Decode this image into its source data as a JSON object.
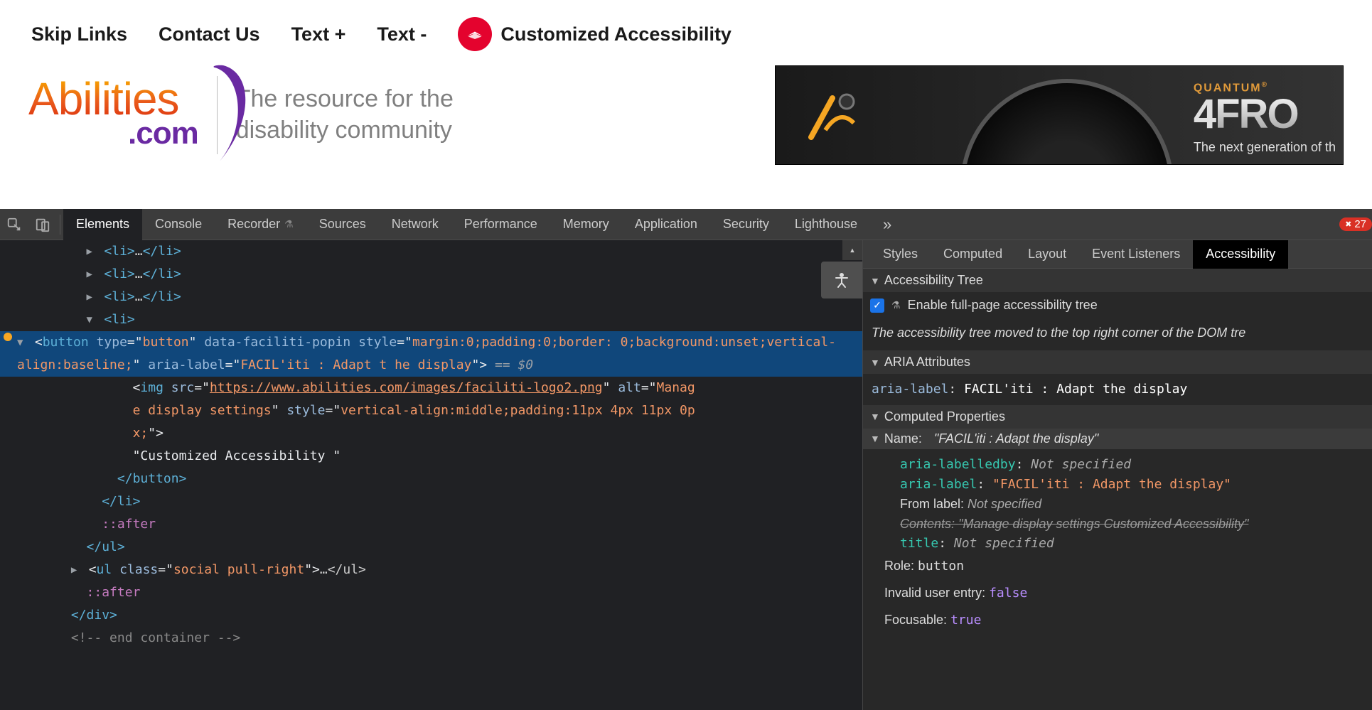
{
  "topnav": {
    "skip_links": "Skip Links",
    "contact_us": "Contact Us",
    "text_plus": "Text +",
    "text_minus": "Text -",
    "custom_accessibility": "Customized Accessibility"
  },
  "logo": {
    "main": "Abilities",
    "sub": ".com",
    "tagline_line1": "The resource for the",
    "tagline_line2": "disability community"
  },
  "ad": {
    "quantum": "QUANTUM",
    "four": "4",
    "fro": "FRO",
    "subtitle": "The next generation of th"
  },
  "devtools_tabs": {
    "elements": "Elements",
    "console": "Console",
    "recorder": "Recorder",
    "sources": "Sources",
    "network": "Network",
    "performance": "Performance",
    "memory": "Memory",
    "application": "Application",
    "security": "Security",
    "lighthouse": "Lighthouse",
    "error_count": "27"
  },
  "side_tabs": {
    "styles": "Styles",
    "computed": "Computed",
    "layout": "Layout",
    "event_listeners": "Event Listeners",
    "accessibility": "Accessibility"
  },
  "dom": {
    "li_collapsed": "<li>…</li>",
    "li_open": "<li>",
    "button_tag_open": "button",
    "button_type_attr": "type",
    "button_type_val": "button",
    "button_data_attr": "data-faciliti-popin",
    "button_style_attr": "style",
    "button_style_val_1": "margin:0;padding:0;border:",
    "button_style_val_2": "0;background:unset;vertical-align:baseline;",
    "button_aria_attr": "aria-label",
    "button_aria_val": "FACIL'iti : Adapt t",
    "button_aria_val_2": "he display",
    "selected_var": " == $0",
    "img_tag": "img",
    "img_src_attr": "src",
    "img_src_val": "https://www.abilities.com/images/faciliti-logo2.png",
    "img_alt_attr": "alt",
    "img_alt_val_1": "Manag",
    "img_alt_val_2": "e display settings",
    "img_style_attr": "style",
    "img_style_val_1": "vertical-align:middle;padding:11px 4px 11px 0p",
    "img_style_val_2": "x;",
    "text_node": "\"Customized Accessibility \"",
    "button_close": "</button>",
    "li_close": "</li>",
    "after_pseudo": "::after",
    "ul_close": "</ul>",
    "ul_social_open": "ul",
    "ul_social_class_attr": "class",
    "ul_social_class_val": "social pull-right",
    "ul_social_rest": "…</ul>",
    "div_close": "</div>",
    "comment": "<!-- end container -->"
  },
  "acc": {
    "tree_title": "Accessibility Tree",
    "enable_label": "Enable full-page accessibility tree",
    "tree_moved_msg": "The accessibility tree moved to the top right corner of the DOM tre",
    "aria_title": "ARIA Attributes",
    "aria_label_key": "aria-label",
    "aria_label_val": "FACIL'iti : Adapt the display",
    "computed_title": "Computed Properties",
    "name_label": "Name:",
    "name_val": "\"FACIL'iti : Adapt the display\"",
    "aria_labelledby_key": "aria-labelledby",
    "not_specified": "Not specified",
    "aria_label_key2": "aria-label",
    "aria_label_val2": "\"FACIL'iti : Adapt the display\"",
    "from_label_key": "From label",
    "contents_key": "Contents:",
    "contents_val": "\"Manage display settings Customized Accessibility\"",
    "title_key": "title",
    "role_key": "Role:",
    "role_val": "button",
    "invalid_key": "Invalid user entry:",
    "invalid_val": "false",
    "focusable_key": "Focusable:",
    "focusable_val": "true"
  }
}
